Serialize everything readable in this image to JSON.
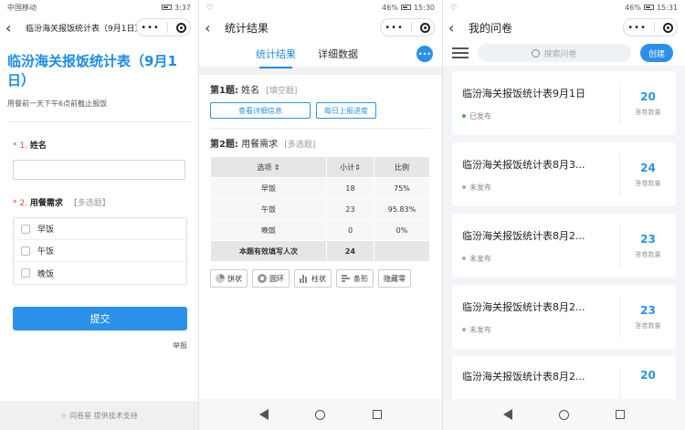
{
  "screen1": {
    "status": {
      "left": "中国移动",
      "right": "3:37"
    },
    "nav_title": "临汾海关报饭统计表（9月1日）",
    "form_title": "临汾海关报饭统计表（9月1日）",
    "form_desc": "用餐前一天下午6点前截止报饭",
    "q1": {
      "num": "* 1.",
      "label": "姓名"
    },
    "q2": {
      "num": "* 2.",
      "label": "用餐需求",
      "tag": "【多选题】"
    },
    "options": [
      "早饭",
      "午饭",
      "晚饭"
    ],
    "submit_label": "提交",
    "report_label": "举报",
    "footer": "☆ 问卷星 提供技术支持"
  },
  "screen2": {
    "status": {
      "battery": "46%",
      "time": "15:30"
    },
    "nav_title": "统计结果",
    "tabs": [
      "统计结果",
      "详细数据"
    ],
    "more": "•••",
    "q1": {
      "label": "第1题:",
      "name": "姓名",
      "tag": "[填空题]"
    },
    "btn_detail": "查看详细信息",
    "btn_progress": "每日上报进度",
    "q2": {
      "label": "第2题:",
      "name": "用餐需求",
      "tag": "[多选题]"
    },
    "table": {
      "headers": [
        "选项 ⇕",
        "小计⇕",
        "比例"
      ],
      "rows": [
        [
          "早饭",
          "18",
          "75%"
        ],
        [
          "午饭",
          "23",
          "95.83%"
        ],
        [
          "晚饭",
          "0",
          "0%"
        ]
      ],
      "summary_label": "本题有效填写人次",
      "summary_value": "24"
    },
    "chart_buttons": [
      "饼状",
      "圆环",
      "柱状",
      "条形",
      "隐藏零"
    ]
  },
  "screen3": {
    "status": {
      "battery": "46%",
      "time": "15:31"
    },
    "nav_title": "我的问卷",
    "search_placeholder": "搜索问卷",
    "create_label": "创建",
    "cards": [
      {
        "title": "临汾海关报饭统计表9月1日",
        "status": "已发布",
        "count": "20",
        "count_label": "答卷数量"
      },
      {
        "title": "临汾海关报饭统计表8月3...",
        "status": "未发布",
        "count": "24",
        "count_label": "答卷数量"
      },
      {
        "title": "临汾海关报饭统计表8月2...",
        "status": "未发布",
        "count": "23",
        "count_label": "答卷数量"
      },
      {
        "title": "临汾海关报饭统计表8月2...",
        "status": "未发布",
        "count": "23",
        "count_label": "答卷数量"
      },
      {
        "title": "临汾海关报饭统计表8月2...",
        "status": "",
        "count": "20",
        "count_label": ""
      }
    ]
  }
}
